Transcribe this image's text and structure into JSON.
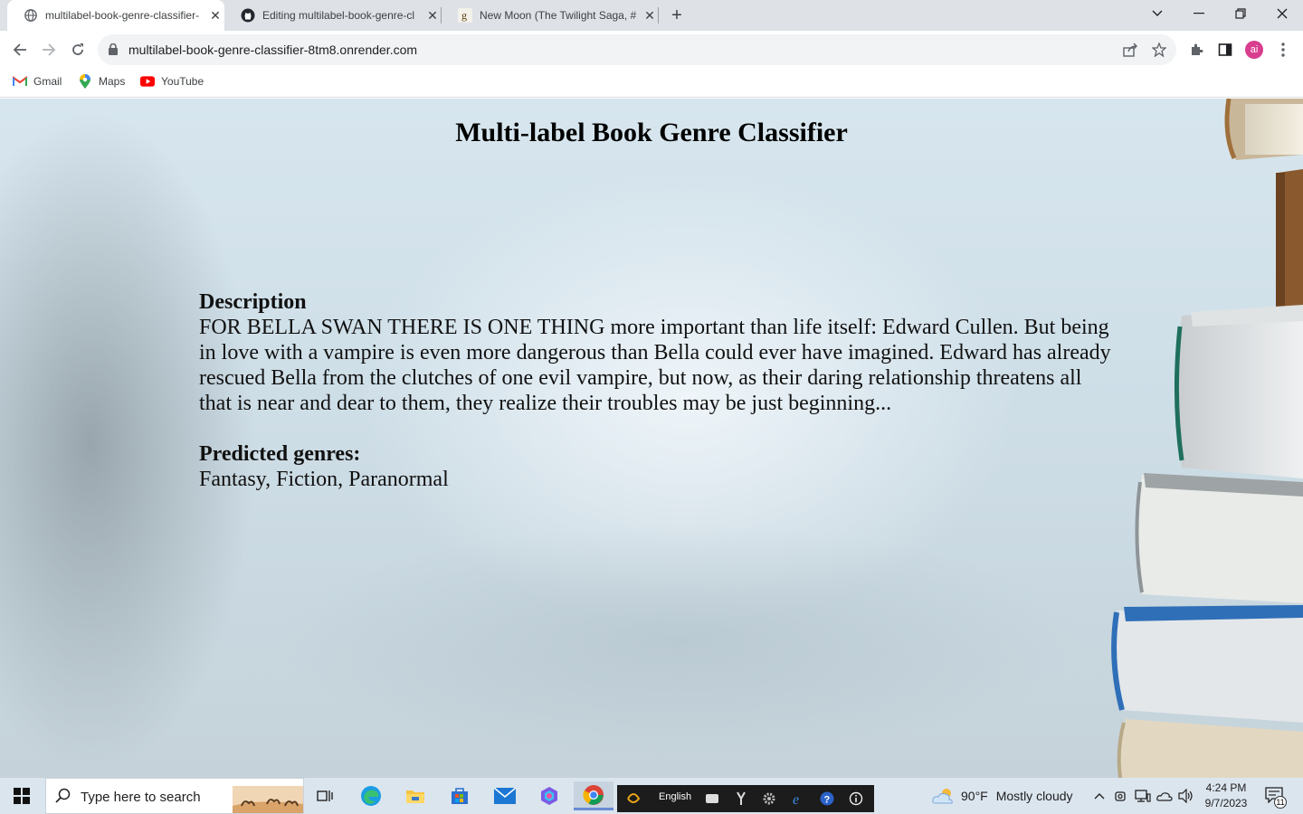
{
  "browser": {
    "tabs": [
      {
        "title": "multilabel-book-genre-classifier-",
        "icon": "globe-icon",
        "active": true
      },
      {
        "title": "Editing multilabel-book-genre-cl",
        "icon": "github-icon",
        "active": false
      },
      {
        "title": "New Moon (The Twilight Saga, #",
        "icon": "goodreads-icon",
        "active": false
      }
    ],
    "new_tab_label": "+",
    "url": "multilabel-book-genre-classifier-8tm8.onrender.com",
    "profile_initials": "ai",
    "bookmarks": [
      {
        "label": "Gmail",
        "icon": "gmail-icon"
      },
      {
        "label": "Maps",
        "icon": "maps-icon"
      },
      {
        "label": "YouTube",
        "icon": "youtube-icon"
      }
    ]
  },
  "page": {
    "title": "Multi-label Book Genre Classifier",
    "description_heading": "Description",
    "description_text": "FOR BELLA SWAN THERE IS ONE THING more important than life itself: Edward Cullen. But being in love with a vampire is even more dangerous than Bella could ever have imagined. Edward has already rescued Bella from the clutches of one evil vampire, but now, as their daring relationship threatens all that is near and dear to them, they realize their troubles may be just beginning...",
    "genres_heading": "Predicted genres:",
    "genres_text": "Fantasy, Fiction, Paranormal"
  },
  "taskbar": {
    "search_placeholder": "Type here to search",
    "language": "English",
    "weather_temp": "90°F",
    "weather_desc": "Mostly cloudy",
    "time": "4:24 PM",
    "date": "9/7/2023",
    "notification_count": "11"
  },
  "colors": {
    "profile_avatar": "#d83d8e",
    "taskbar_bg": "#dbe5ee",
    "tabstrip_bg": "#dee1e6"
  }
}
